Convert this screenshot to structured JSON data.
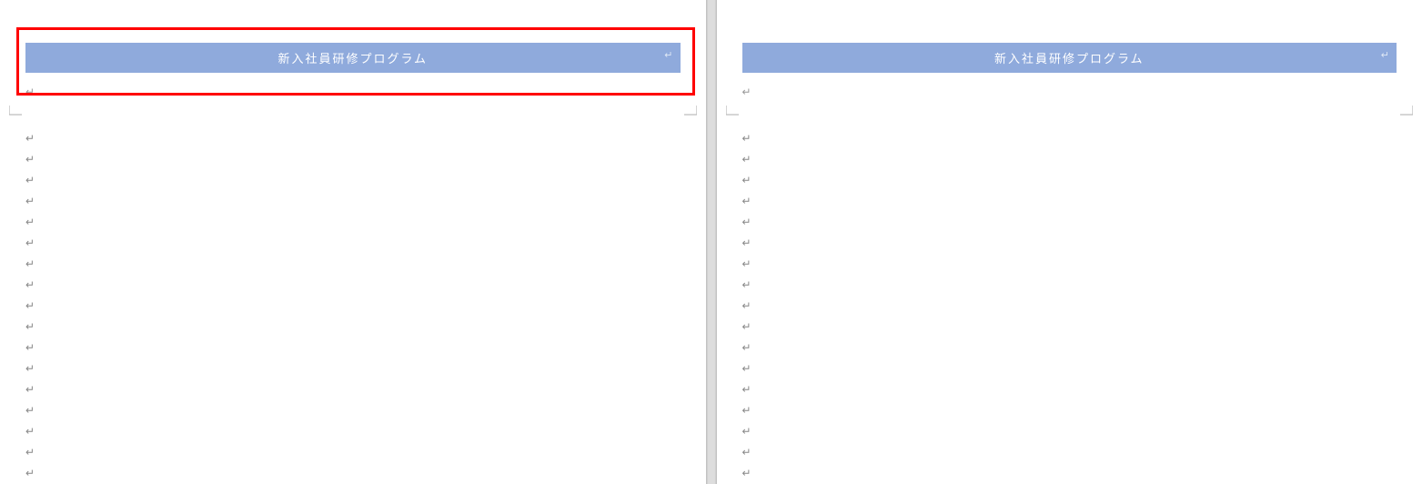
{
  "pages": {
    "left": {
      "header_title": "新入社員研修プログラム",
      "highlighted": true,
      "body_line_count": 17
    },
    "right": {
      "header_title": "新入社員研修プログラム",
      "highlighted": false,
      "body_line_count": 17
    }
  },
  "colors": {
    "banner_bg": "#8faadc",
    "banner_fg": "#ffffff",
    "highlight": "#ff0000"
  },
  "paragraph_mark_glyph": "↵"
}
